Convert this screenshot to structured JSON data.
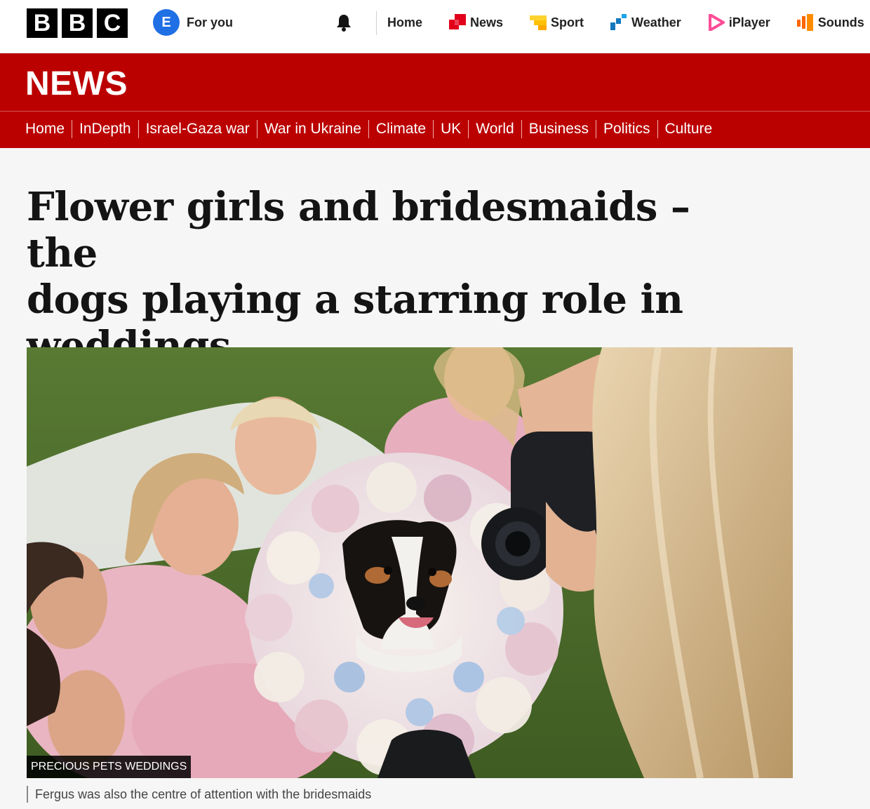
{
  "topbar": {
    "logo_letters": [
      "B",
      "B",
      "C"
    ],
    "avatar_initial": "E",
    "for_you_label": "For you",
    "nav": [
      {
        "label": "Home",
        "icon": "home"
      },
      {
        "label": "News",
        "icon": "news-icon",
        "color": "#e2001a"
      },
      {
        "label": "Sport",
        "icon": "sport-icon",
        "color": "#ffd230"
      },
      {
        "label": "Weather",
        "icon": "weather-icon",
        "color": "#1479be"
      },
      {
        "label": "iPlayer",
        "icon": "iplayer-icon",
        "color": "#ff4c98"
      },
      {
        "label": "Sounds",
        "icon": "sounds-icon",
        "color": "#ff6600"
      }
    ]
  },
  "news_band": {
    "logo": "NEWS",
    "color": "#bb0000"
  },
  "subnav": [
    "Home",
    "InDepth",
    "Israel-Gaza war",
    "War in Ukraine",
    "Climate",
    "UK",
    "World",
    "Business",
    "Politics",
    "Culture"
  ],
  "article": {
    "headline_lines": [
      "Flower girls and bridesmaids – the",
      "dogs playing a starring role in",
      "weddings"
    ],
    "image_credit": "PRECIOUS PETS WEDDINGS",
    "caption": "Fergus was also the centre of attention with the bridesmaids"
  }
}
